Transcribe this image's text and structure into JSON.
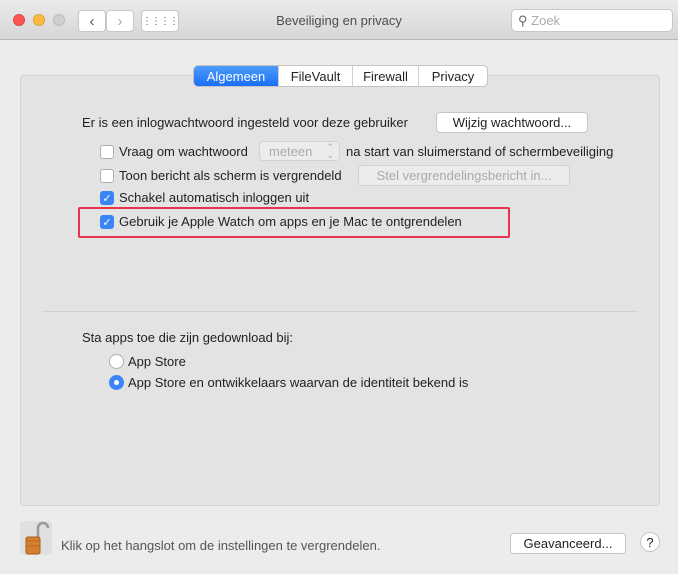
{
  "window": {
    "title": "Beveiliging en privacy",
    "search_placeholder": "Zoek"
  },
  "tabs": [
    {
      "label": "Algemeen",
      "active": true
    },
    {
      "label": "FileVault"
    },
    {
      "label": "Firewall"
    },
    {
      "label": "Privacy"
    }
  ],
  "general": {
    "password_text": "Er is een inlogwachtwoord ingesteld voor deze gebruiker",
    "change_password": "Wijzig wachtwoord...",
    "require_password": {
      "label": "Vraag om wachtwoord",
      "checked": false,
      "select_value": "meteen",
      "suffix": "na start van sluimerstand of schermbeveiliging"
    },
    "show_message": {
      "label": "Toon bericht als scherm is vergrendeld",
      "checked": false,
      "button": "Stel vergrendelingsbericht in..."
    },
    "disable_autologin": {
      "label": "Schakel automatisch inloggen uit",
      "checked": true
    },
    "apple_watch": {
      "label": "Gebruik je Apple Watch om apps en je Mac te ontgrendelen",
      "checked": true,
      "highlight_color": "#e8344a"
    },
    "allow_apps_label": "Sta apps toe die zijn gedownload bij:",
    "radio_options": [
      {
        "label": "App Store",
        "selected": false
      },
      {
        "label": "App Store en ontwikkelaars waarvan de identiteit bekend is",
        "selected": true
      }
    ]
  },
  "footer": {
    "lock_text": "Klik op het hangslot om de instellingen te vergrendelen.",
    "advanced": "Geavanceerd...",
    "help": "?"
  }
}
